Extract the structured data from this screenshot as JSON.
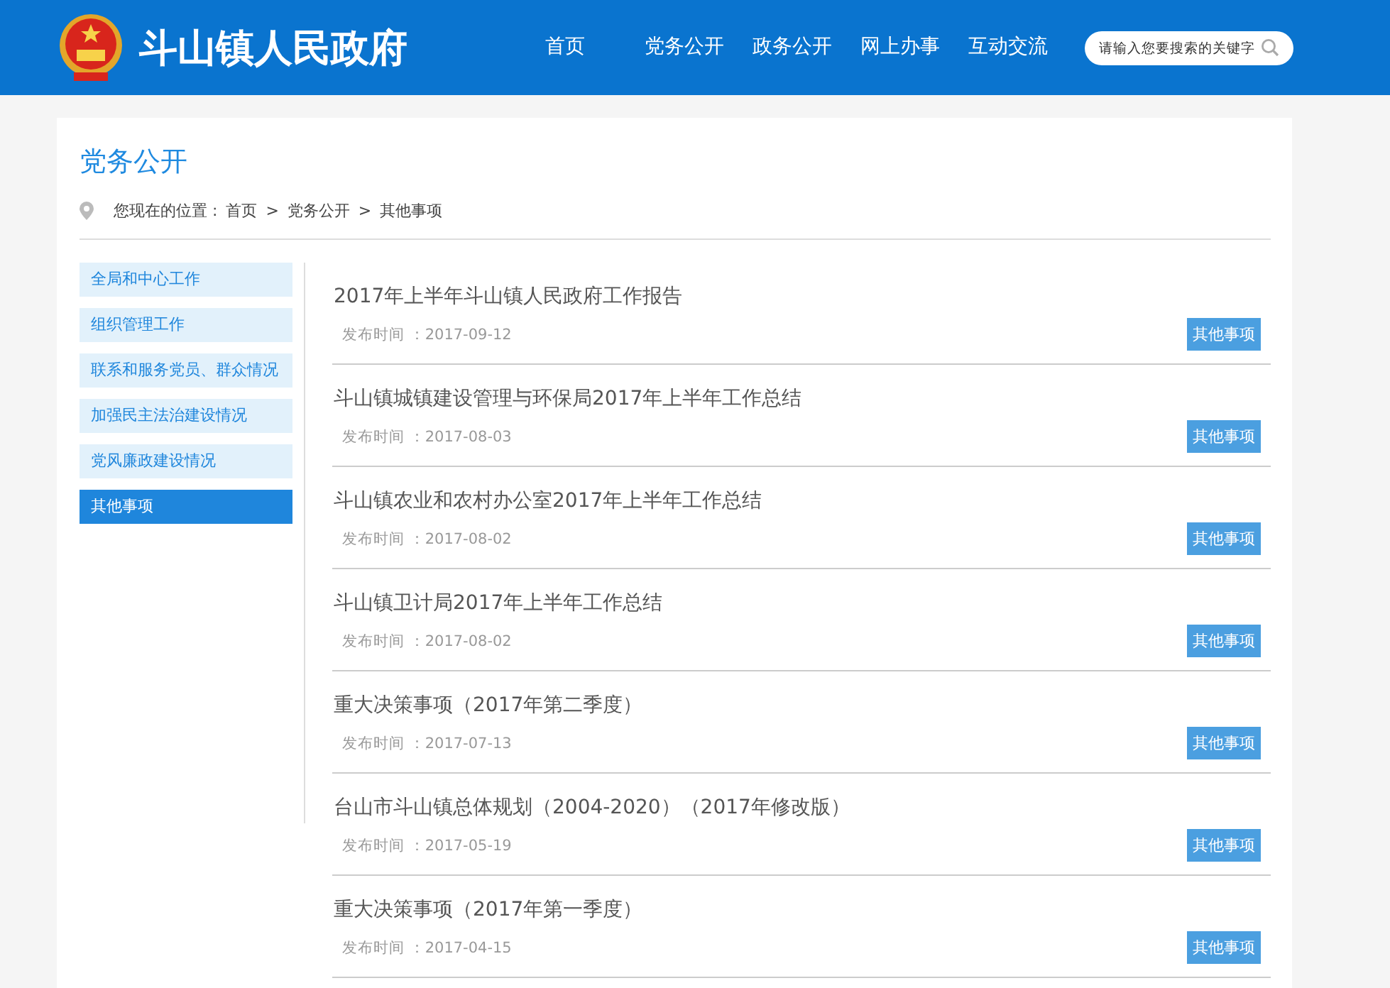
{
  "header": {
    "site_title": "斗山镇人民政府",
    "nav": [
      {
        "label": "首页",
        "selected": false
      },
      {
        "label": "党务公开",
        "selected": false
      },
      {
        "label": "政务公开",
        "selected": false
      },
      {
        "label": "网上办事",
        "selected": false
      },
      {
        "label": "互动交流",
        "selected": false
      }
    ],
    "search": {
      "placeholder": "请输入您要搜索的关键字"
    }
  },
  "section_title": "党务公开",
  "breadcrumb": {
    "prefix": "您现在的位置 :",
    "items": [
      "首页",
      "党务公开",
      "其他事项"
    ],
    "separator": ">"
  },
  "sidebar": {
    "items": [
      {
        "label": "全局和中心工作",
        "selected": false
      },
      {
        "label": "组织管理工作",
        "selected": false
      },
      {
        "label": "联系和服务党员、群众情况",
        "selected": false
      },
      {
        "label": "加强民主法治建设情况",
        "selected": false
      },
      {
        "label": "党风廉政建设情况",
        "selected": false
      },
      {
        "label": "其他事项",
        "selected": true
      }
    ]
  },
  "articles": [
    {
      "title": "2017年上半年斗山镇人民政府工作报告",
      "published": "发布时间 ：2017-09-12",
      "tag": "其他事项"
    },
    {
      "title": "斗山镇城镇建设管理与环保局2017年上半年工作总结",
      "published": "发布时间 ：2017-08-03",
      "tag": "其他事项"
    },
    {
      "title": "斗山镇农业和农村办公室2017年上半年工作总结",
      "published": "发布时间 ：2017-08-02",
      "tag": "其他事项"
    },
    {
      "title": "斗山镇卫计局2017年上半年工作总结",
      "published": "发布时间 ：2017-08-02",
      "tag": "其他事项"
    },
    {
      "title": "重大决策事项（2017年第二季度）",
      "published": "发布时间 ：2017-07-13",
      "tag": "其他事项"
    },
    {
      "title": "台山市斗山镇总体规划（2004-2020）（2017年修改版）",
      "published": "发布时间 ：2017-05-19",
      "tag": "其他事项"
    },
    {
      "title": "重大决策事项（2017年第一季度）",
      "published": "发布时间 ：2017-04-15",
      "tag": "其他事项"
    }
  ]
}
